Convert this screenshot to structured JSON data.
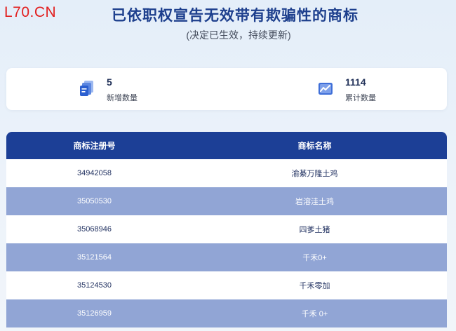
{
  "logo": "L70.CN",
  "header": {
    "title": "已依职权宣告无效带有欺骗性的商标",
    "subtitle": "(决定已生效，持续更新)"
  },
  "stats": {
    "new": {
      "value": "5",
      "label": "新增数量",
      "icon": "stack-new-icon"
    },
    "total": {
      "value": "1114",
      "label": "累计数量",
      "icon": "trend-chart-icon"
    }
  },
  "table": {
    "headers": [
      "商标注册号",
      "商标名称"
    ],
    "rows": [
      {
        "reg_no": "34942058",
        "name": "渝綦万隆土鸡"
      },
      {
        "reg_no": "35050530",
        "name": "岩溶洼土鸡"
      },
      {
        "reg_no": "35068946",
        "name": "四爹土猪"
      },
      {
        "reg_no": "35121564",
        "name": "千禾0+"
      },
      {
        "reg_no": "35124530",
        "name": "千禾零加"
      },
      {
        "reg_no": "35126959",
        "name": "千禾 0+"
      }
    ]
  },
  "colors": {
    "brand_red": "#e21e1e",
    "title_blue": "#1d3f8d",
    "header_blue": "#1c3f96",
    "row_alt": "#91a5d5"
  }
}
